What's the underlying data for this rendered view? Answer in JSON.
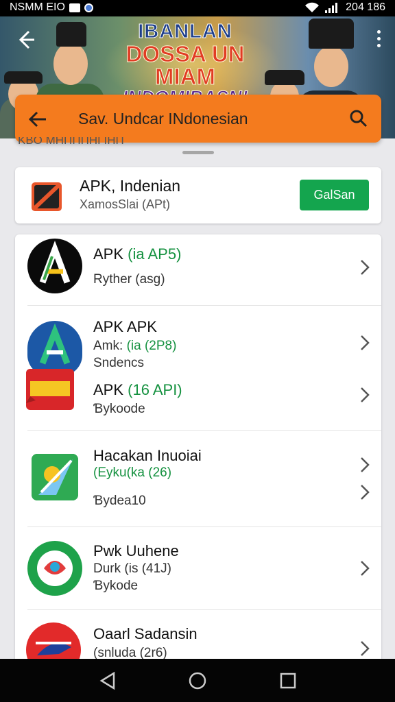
{
  "status_bar": {
    "carrier": "NSMM ΕΙΟ",
    "time": "204 186"
  },
  "banner": {
    "line1": "IBANLAN",
    "line2": "DOSSA UN MIAM",
    "line3": "INDOMIBASN!"
  },
  "search": {
    "text": "Sav. Undcar INdonesian"
  },
  "section_heading": "ΚΒΟ ΜΗΠΠΠΗΓΙΗΠ",
  "featured": {
    "title": "APK, Indenian",
    "subtitle": "XamosSlai (APt)",
    "button_label": "GalSan"
  },
  "list": {
    "items": [
      {
        "line1": "APK",
        "line1_green": "(ia AP5)",
        "line2": "Ryther (asg)"
      },
      {
        "line1": "APK APK",
        "line2": "Amk:",
        "line2_green": "(ia (2P8)",
        "line3": "Sndencs"
      },
      {
        "line1": "APK",
        "line1_green": "(16 API)",
        "line2": "Ɓykoode"
      },
      {
        "line1": "Hacakan Inuoiai",
        "line2_green": "(Eyku(ka (26)",
        "line3": "Ɓydea10"
      },
      {
        "line1": "Pwk Uuhene",
        "line2": "Durk (is (41J)",
        "line3": "Ɓykode"
      },
      {
        "line1": "Oaarl Sadansin",
        "line2": "(snluda (2r6)"
      }
    ]
  },
  "icons": {
    "featured": "featured-app-icon",
    "app1": "a-logo-icon",
    "app2": "a-shield-icon",
    "app2b": "red-ribbon-icon",
    "app3": "maps-icon",
    "app4": "green-badge-icon",
    "app5": "red-shark-icon"
  },
  "colors": {
    "accent": "#f47b1e",
    "button": "#14a54e",
    "link_green": "#14913f"
  }
}
